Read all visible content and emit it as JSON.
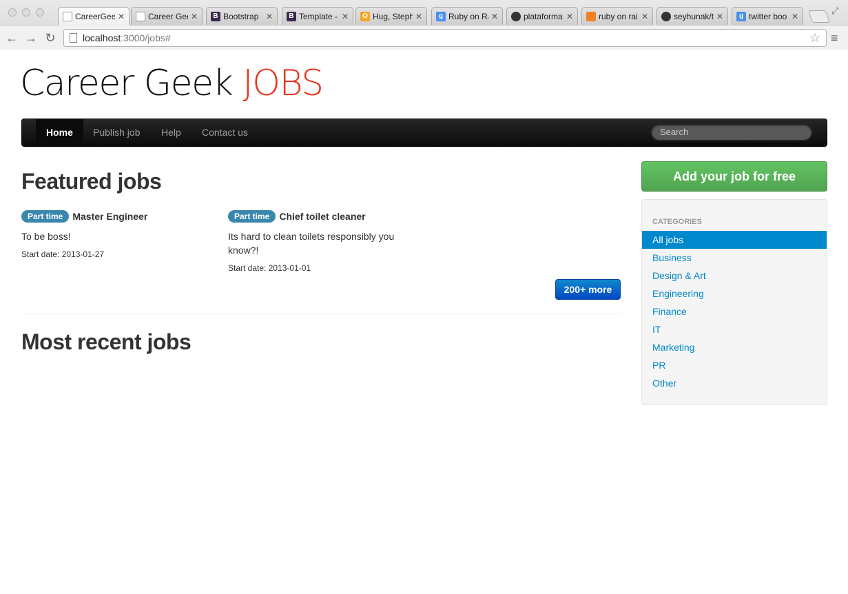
{
  "browser": {
    "tabs": [
      {
        "label": "CareerGeek",
        "icon": "document-icon",
        "active": true
      },
      {
        "label": "Career Gee",
        "icon": "document-icon"
      },
      {
        "label": "Bootstrap",
        "icon": "bootstrap-icon"
      },
      {
        "label": "Template -",
        "icon": "bootstrap-icon"
      },
      {
        "label": "Hug, Steph",
        "icon": "outlook-icon"
      },
      {
        "label": "Ruby on Ra",
        "icon": "google-icon"
      },
      {
        "label": "plataforma",
        "icon": "github-icon"
      },
      {
        "label": "ruby on rai",
        "icon": "stackoverflow-icon"
      },
      {
        "label": "seyhunak/t",
        "icon": "github-icon"
      },
      {
        "label": "twitter boo",
        "icon": "google-icon"
      }
    ],
    "url_host": "localhost",
    "url_rest": ":3000/jobs#"
  },
  "site": {
    "brand_main": "Career Geek",
    "brand_accent": "JOBS",
    "brand_accent_color": "#e8351f"
  },
  "nav": {
    "items": [
      "Home",
      "Publish job",
      "Help",
      "Contact us"
    ],
    "active": "Home",
    "search_placeholder": "Search"
  },
  "featured": {
    "heading": "Featured jobs",
    "jobs": [
      {
        "badge": "Part time",
        "title": "Master Engineer",
        "description": "To be boss!",
        "start_date": "Start date: 2013-01-27"
      },
      {
        "badge": "Part time",
        "title": "Chief toilet cleaner",
        "description": "Its hard to clean toilets responsibly you know?!",
        "start_date": "Start date: 2013-01-01"
      }
    ],
    "more_label": "200+ more"
  },
  "recent": {
    "heading": "Most recent jobs"
  },
  "sidebar": {
    "add_job_label": "Add your job for free",
    "categories_heading": "CATEGORIES",
    "categories": [
      "All jobs",
      "Business",
      "Design & Art",
      "Engineering",
      "Finance",
      "IT",
      "Marketing",
      "PR",
      "Other"
    ],
    "active_category": "All jobs"
  }
}
